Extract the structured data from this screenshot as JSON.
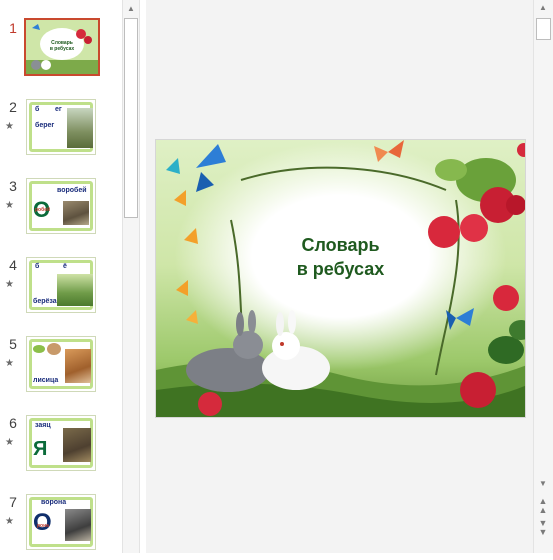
{
  "slides": [
    {
      "number": "1",
      "active": true,
      "star": false,
      "texts": [
        "Словарь",
        "в ребусах"
      ]
    },
    {
      "number": "2",
      "star": true,
      "texts": [
        "б",
        "ег",
        "берег"
      ]
    },
    {
      "number": "3",
      "star": true,
      "texts": [
        "О",
        "воробей",
        "робей"
      ]
    },
    {
      "number": "4",
      "star": true,
      "texts": [
        "б",
        "ё",
        "берёза"
      ]
    },
    {
      "number": "5",
      "star": true,
      "texts": [
        "лисица"
      ]
    },
    {
      "number": "6",
      "star": true,
      "texts": [
        "заяц",
        "Я"
      ]
    },
    {
      "number": "7",
      "star": true,
      "texts": [
        "ворона",
        "О",
        "рона"
      ]
    }
  ],
  "star_glyph": "★",
  "main_slide": {
    "title_line1": "Словарь",
    "title_line2": "в ребусах"
  },
  "colors": {
    "active_border": "#c9492e",
    "active_number": "#c0392b",
    "title_green": "#1f5a1f"
  }
}
